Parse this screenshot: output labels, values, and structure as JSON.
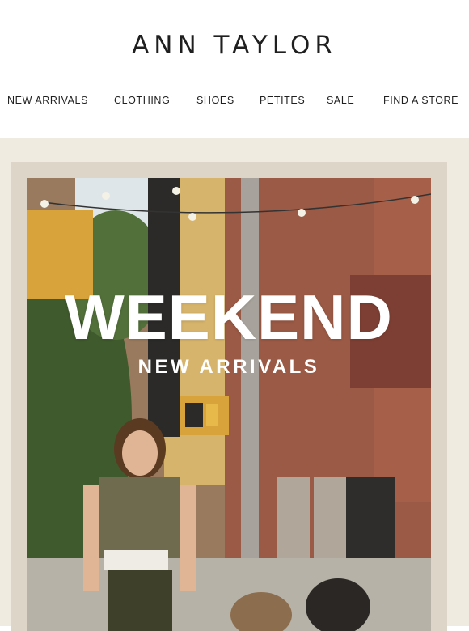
{
  "brand": {
    "name": "ANN TAYLOR"
  },
  "nav": {
    "items": [
      {
        "label": "NEW ARRIVALS"
      },
      {
        "label": "CLOTHING"
      },
      {
        "label": "SHOES"
      },
      {
        "label": "PETITES"
      },
      {
        "label": "SALE"
      },
      {
        "label": "FIND A STORE"
      }
    ]
  },
  "hero": {
    "headline": "WEEKEND",
    "subheadline": "NEW ARRIVALS",
    "image_description_icon": "street-photo-woman-dogs"
  },
  "colors": {
    "background": "#efebe1",
    "frame": "#dcd5c8",
    "text": "#1f1f1f"
  }
}
